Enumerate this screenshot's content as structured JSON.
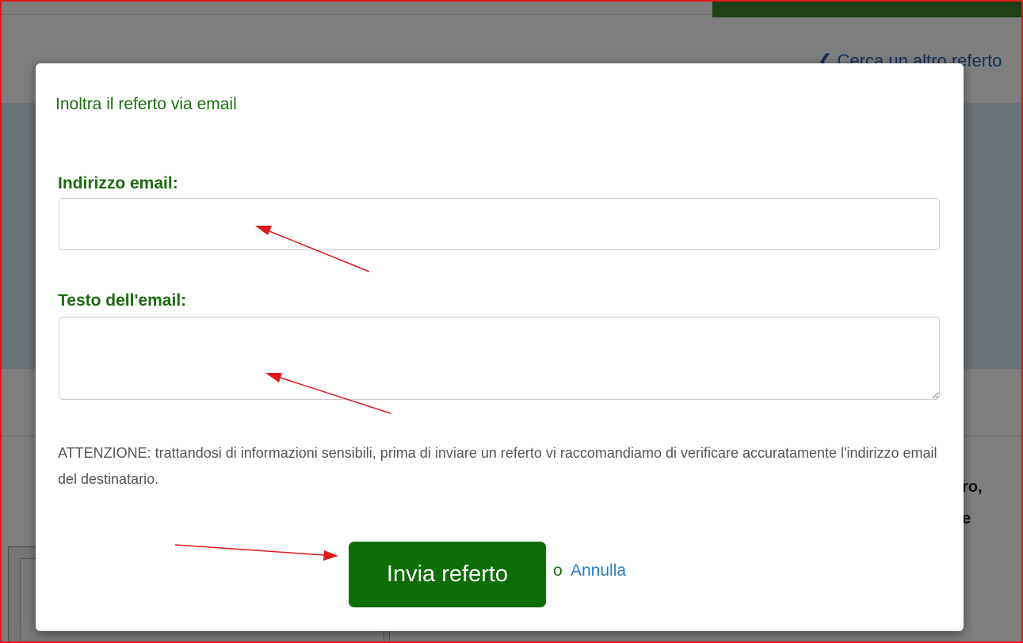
{
  "background": {
    "back_link": "❮ Cerca un altro referto",
    "side_text_1": "ro,",
    "side_text_2": "e"
  },
  "modal": {
    "title": "Inoltra il referto via email",
    "email_label": "Indirizzo email:",
    "email_value": "",
    "body_label": "Testo dell'email:",
    "body_value": "",
    "warning": "ATTENZIONE: trattandosi di informazioni sensibili, prima di inviare un referto vi raccomandiamo di verificare accuratamente l'indirizzo email del destinatario.",
    "send_label": "Invia referto",
    "or_text": "o",
    "cancel_label": "Annulla"
  },
  "colors": {
    "accent_green": "#0d6e06",
    "label_green": "#1c6b10",
    "link_blue": "#2b7ec2",
    "annotation_red": "#e0191c",
    "overlay": "rgba(0,0,0,0.5)"
  }
}
